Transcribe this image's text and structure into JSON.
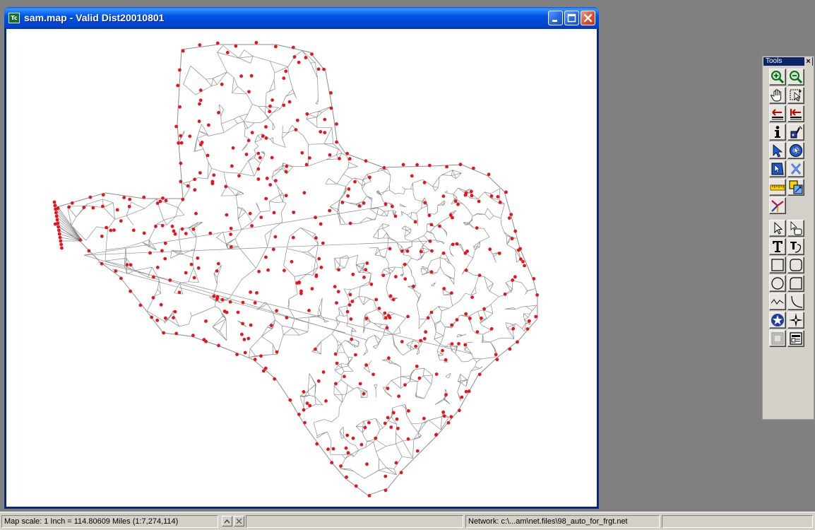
{
  "window": {
    "title": "sam.map - Valid Dist20010801",
    "icon": "map-app-icon",
    "icon_text": "Tc"
  },
  "map": {
    "network_color": "#8c8c8c",
    "centroid_color": "#e8141c",
    "background": "#ffffff"
  },
  "tools": {
    "title": "Tools",
    "close_label": "×",
    "buttons": [
      {
        "name": "zoom-in-icon"
      },
      {
        "name": "zoom-out-icon"
      },
      {
        "name": "pan-hand-icon"
      },
      {
        "name": "zoom-to-cursor-icon"
      },
      {
        "name": "previous-scale-icon"
      },
      {
        "name": "full-extent-icon"
      },
      {
        "name": "info-icon"
      },
      {
        "name": "hotlink-icon"
      },
      {
        "name": "pointer-select-icon"
      },
      {
        "name": "radius-select-icon"
      },
      {
        "name": "polygon-select-icon"
      },
      {
        "name": "clear-selection-icon"
      },
      {
        "name": "ruler-icon"
      },
      {
        "name": "map-layers-icon"
      },
      {
        "name": "network-path-icon"
      },
      {
        "name": "arrow-select-icon"
      },
      {
        "name": "hand-arrow-icon"
      },
      {
        "name": "text-icon"
      },
      {
        "name": "curved-text-icon"
      },
      {
        "name": "rectangle-icon"
      },
      {
        "name": "rounded-rectangle-icon"
      },
      {
        "name": "circle-icon"
      },
      {
        "name": "freehand-shape-icon"
      },
      {
        "name": "polyline-icon"
      },
      {
        "name": "arc-icon"
      },
      {
        "name": "star-symbol-icon"
      },
      {
        "name": "north-arrow-icon"
      },
      {
        "name": "frame-icon"
      },
      {
        "name": "legend-icon"
      }
    ]
  },
  "status_bar": {
    "scale": "Map scale: 1 Inch = 114.80609 Miles (1:7,274,114)",
    "network": "Network: c:\\...am\\net.files\\98_auto_for_frgt.net"
  }
}
